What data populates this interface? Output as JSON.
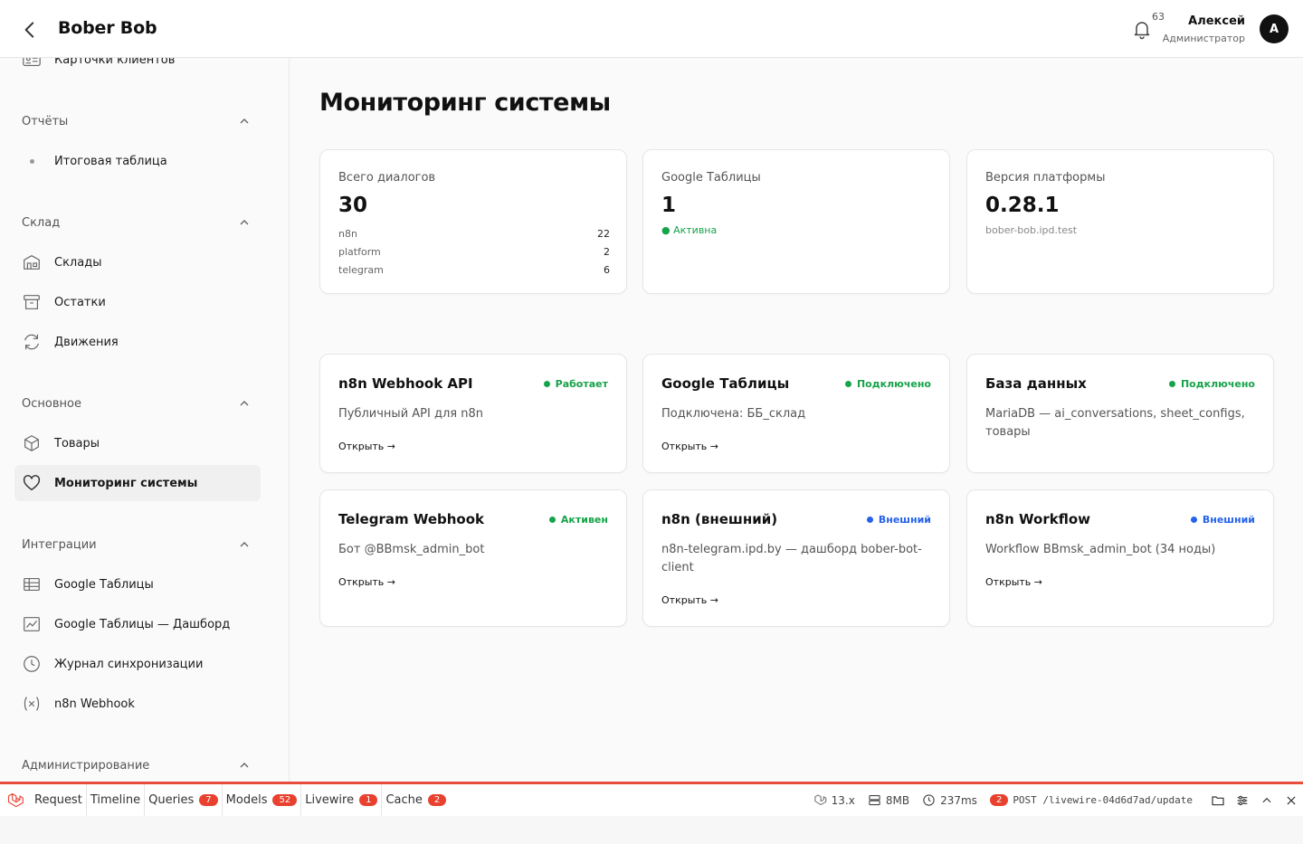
{
  "header": {
    "brand": "Bober Bob",
    "notifications_count": "63",
    "user_name": "Алексей",
    "user_role": "Администратор",
    "avatar_initial": "A"
  },
  "sidebar": {
    "partial_top": "Карточки клиентов",
    "groups": {
      "reports": {
        "label": "Отчёты",
        "items": [
          "Итоговая таблица"
        ]
      },
      "warehouse": {
        "label": "Склад",
        "items": [
          "Склады",
          "Остатки",
          "Движения"
        ]
      },
      "main": {
        "label": "Основное",
        "items": [
          "Товары",
          "Мониторинг системы"
        ]
      },
      "integrations": {
        "label": "Интеграции",
        "items": [
          "Google Таблицы",
          "Google Таблицы — Дашборд",
          "Журнал синхронизации",
          "n8n Webhook"
        ]
      },
      "admin": {
        "label": "Администрирование"
      }
    }
  },
  "page": {
    "title": "Мониторинг системы"
  },
  "stats": {
    "dialogs": {
      "label": "Всего диалогов",
      "value": "30",
      "sources": [
        {
          "name": "n8n",
          "count": "22"
        },
        {
          "name": "platform",
          "count": "2"
        },
        {
          "name": "telegram",
          "count": "6"
        }
      ]
    },
    "sheets": {
      "label": "Google Таблицы",
      "value": "1",
      "status": "● Активна"
    },
    "version": {
      "label": "Версия платформы",
      "value": "0.28.1",
      "host": "bober-bob.ipd.test"
    }
  },
  "services": [
    {
      "title": "n8n Webhook API",
      "status": "Работает",
      "desc": "Публичный API для n8n",
      "link": "Открыть →"
    },
    {
      "title": "Google Таблицы",
      "status": "Подключено",
      "desc": "Подключена: ББ_склад",
      "link": "Открыть →"
    },
    {
      "title": "База данных",
      "status": "Подключено",
      "desc": "MariaDB — ai_conversations, sheet_configs, товары",
      "link": ""
    },
    {
      "title": "Telegram Webhook",
      "status": "Активен",
      "desc": "Бот @BBmsk_admin_bot",
      "link": "Открыть →"
    },
    {
      "title": "n8n (внешний)",
      "status": "Внешний",
      "desc": "n8n-telegram.ipd.by — дашборд bober-bot-client",
      "link": "Открыть →"
    },
    {
      "title": "n8n Workflow",
      "status": "Внешний",
      "desc": "Workflow BBmsk_admin_bot (34 ноды)",
      "link": "Открыть →"
    }
  ],
  "colors": {
    "green": "#16a34a",
    "blue": "#2563eb",
    "debug_red": "#e84c3d"
  },
  "debugbar": {
    "tabs": {
      "request": "Request",
      "timeline": "Timeline",
      "queries": "Queries",
      "queries_count": "7",
      "models": "Models",
      "models_count": "52",
      "livewire": "Livewire",
      "livewire_count": "1",
      "cache": "Cache",
      "cache_count": "2"
    },
    "laravel_version": "13.x",
    "memory": "8MB",
    "duration": "237ms",
    "request_count": "2",
    "request": "POST /livewire-04d6d7ad/update"
  }
}
